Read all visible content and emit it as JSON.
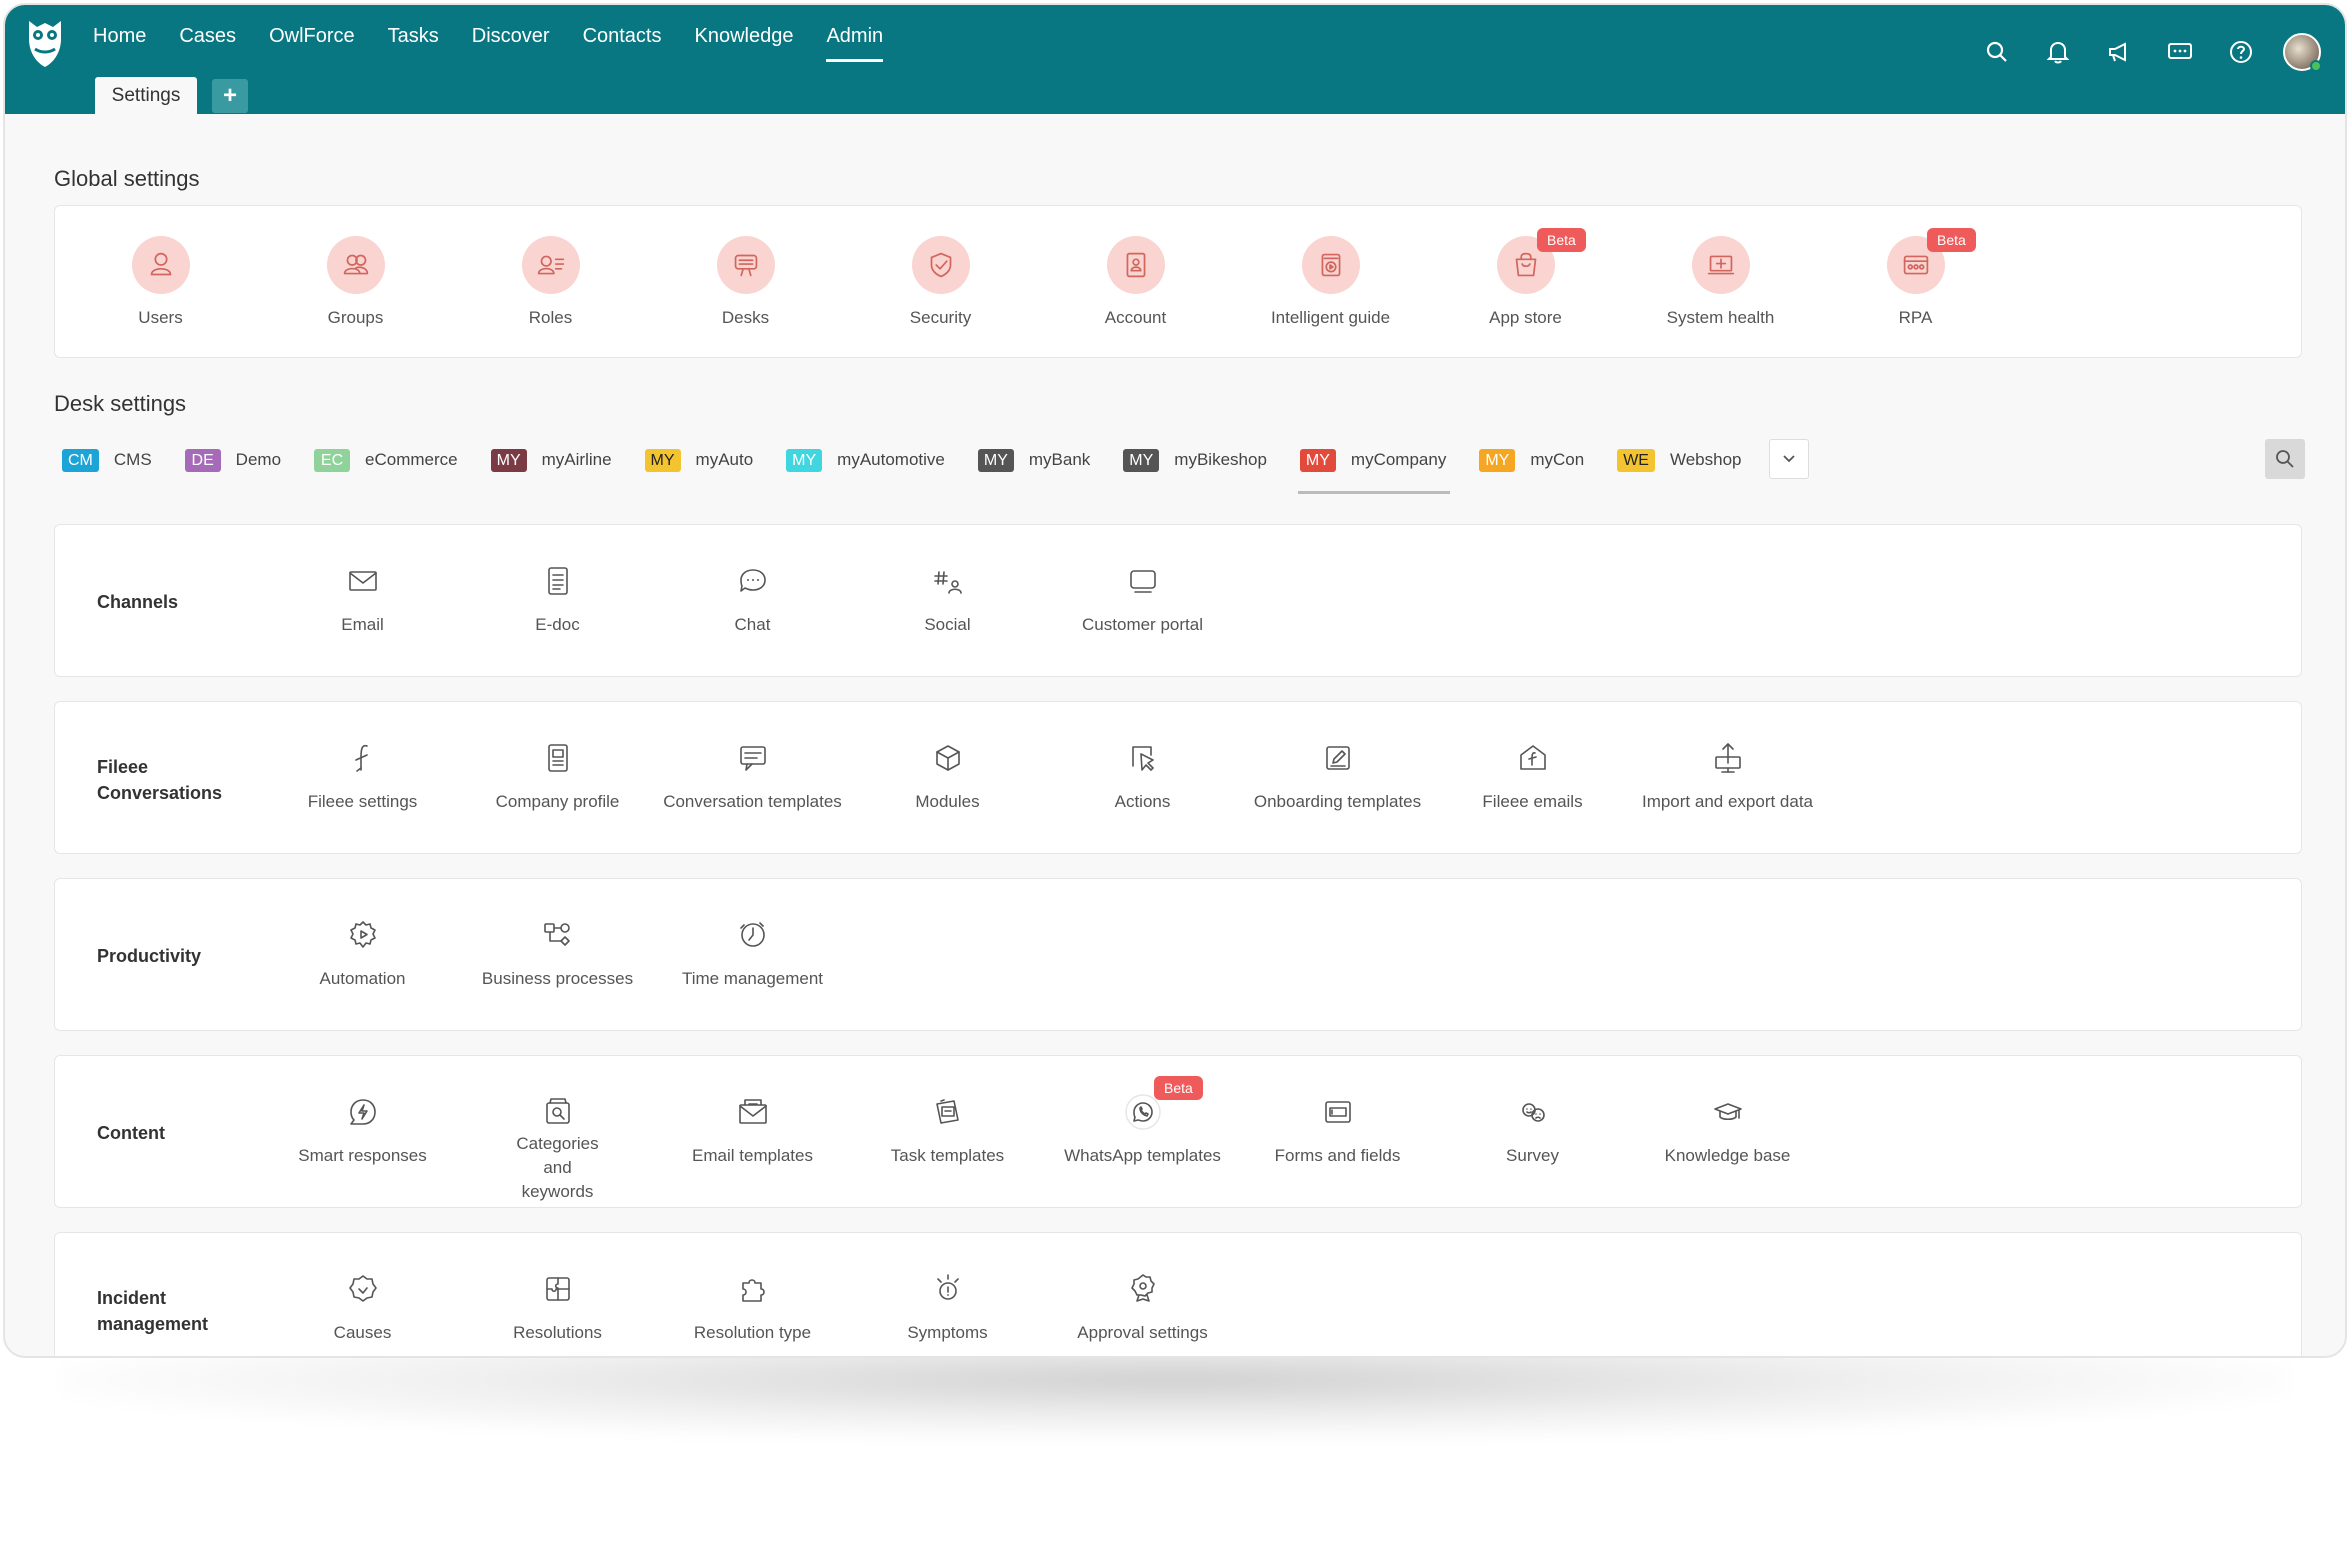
{
  "nav": {
    "items": [
      "Home",
      "Cases",
      "OwlForce",
      "Tasks",
      "Discover",
      "Contacts",
      "Knowledge",
      "Admin"
    ],
    "active": "Admin"
  },
  "tabs": {
    "settings_label": "Settings",
    "add_label": "+"
  },
  "header_icons": [
    "search-icon",
    "bell-icon",
    "megaphone-icon",
    "chat-icon",
    "help-icon"
  ],
  "global": {
    "title": "Global settings",
    "items": [
      {
        "label": "Users",
        "icon": "user-icon"
      },
      {
        "label": "Groups",
        "icon": "groups-icon"
      },
      {
        "label": "Roles",
        "icon": "roles-icon"
      },
      {
        "label": "Desks",
        "icon": "desks-icon"
      },
      {
        "label": "Security",
        "icon": "shield-icon"
      },
      {
        "label": "Account",
        "icon": "account-icon"
      },
      {
        "label": "Intelligent guide",
        "icon": "guide-icon"
      },
      {
        "label": "App store",
        "icon": "store-icon",
        "badge": "Beta"
      },
      {
        "label": "System health",
        "icon": "health-icon"
      },
      {
        "label": "RPA",
        "icon": "rpa-icon",
        "badge": "Beta"
      }
    ]
  },
  "desk": {
    "title": "Desk settings",
    "tabs": [
      {
        "code": "CM",
        "name": "CMS",
        "color": "#1da4d6"
      },
      {
        "code": "DE",
        "name": "Demo",
        "color": "#a66bb8"
      },
      {
        "code": "EC",
        "name": "eCommerce",
        "color": "#8fd39a"
      },
      {
        "code": "MY",
        "name": "myAirline",
        "color": "#7a3b45"
      },
      {
        "code": "MY",
        "name": "myAuto",
        "color": "#f4c430",
        "dark": true
      },
      {
        "code": "MY",
        "name": "myAutomotive",
        "color": "#3fd6e0"
      },
      {
        "code": "MY",
        "name": "myBank",
        "color": "#555555"
      },
      {
        "code": "MY",
        "name": "myBikeshop",
        "color": "#555555"
      },
      {
        "code": "MY",
        "name": "myCompany",
        "color": "#e24b3b",
        "active": true
      },
      {
        "code": "MY",
        "name": "myCon",
        "color": "#f5a623"
      },
      {
        "code": "WE",
        "name": "Webshop",
        "color": "#f4c430",
        "dark": true
      }
    ]
  },
  "rows": [
    {
      "label": "Channels",
      "items": [
        {
          "label": "Email",
          "icon": "envelope-icon"
        },
        {
          "label": "E-doc",
          "icon": "document-icon"
        },
        {
          "label": "Chat",
          "icon": "chat-bubble-icon"
        },
        {
          "label": "Social",
          "icon": "social-icon"
        },
        {
          "label": "Customer portal",
          "icon": "portal-icon"
        }
      ]
    },
    {
      "label": "Fileee Conversations",
      "items": [
        {
          "label": "Fileee settings",
          "icon": "fileee-icon"
        },
        {
          "label": "Company profile",
          "icon": "company-icon"
        },
        {
          "label": "Conversation templates",
          "icon": "conversation-icon"
        },
        {
          "label": "Modules",
          "icon": "cube-icon"
        },
        {
          "label": "Actions",
          "icon": "cursor-icon"
        },
        {
          "label": "Onboarding templates",
          "icon": "edit-icon"
        },
        {
          "label": "Fileee emails",
          "icon": "fileee-mail-icon"
        },
        {
          "label": "Import and export data",
          "icon": "import-export-icon"
        }
      ]
    },
    {
      "label": "Productivity",
      "items": [
        {
          "label": "Automation",
          "icon": "gear-play-icon"
        },
        {
          "label": "Business processes",
          "icon": "process-icon"
        },
        {
          "label": "Time management",
          "icon": "clock-icon"
        }
      ]
    },
    {
      "label": "Content",
      "items": [
        {
          "label": "Smart responses",
          "icon": "smart-response-icon"
        },
        {
          "label": "Categories and keywords",
          "icon": "categories-icon"
        },
        {
          "label": "Email templates",
          "icon": "email-template-icon"
        },
        {
          "label": "Task templates",
          "icon": "task-template-icon"
        },
        {
          "label": "WhatsApp templates",
          "icon": "whatsapp-icon",
          "badge": "Beta"
        },
        {
          "label": "Forms and fields",
          "icon": "form-icon"
        },
        {
          "label": "Survey",
          "icon": "survey-icon"
        },
        {
          "label": "Knowledge base",
          "icon": "graduation-cap-icon"
        }
      ]
    },
    {
      "label": "Incident management",
      "items": [
        {
          "label": "Causes",
          "icon": "causes-icon"
        },
        {
          "label": "Resolutions",
          "icon": "puzzle-icon"
        },
        {
          "label": "Resolution type",
          "icon": "puzzle-piece-icon"
        },
        {
          "label": "Symptoms",
          "icon": "symptoms-icon"
        },
        {
          "label": "Approval settings",
          "icon": "approval-icon"
        }
      ]
    }
  ],
  "colors": {
    "primary": "#087781",
    "accent_circle": "#fad4d0",
    "beta": "#ef5a5a"
  }
}
